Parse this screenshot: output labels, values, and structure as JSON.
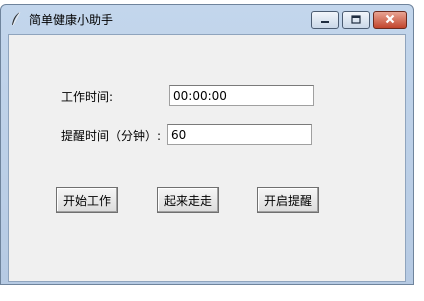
{
  "window": {
    "title": "简单健康小助手"
  },
  "form": {
    "work_time_label": "工作时间:",
    "work_time_value": "00:00:00",
    "remind_label": "提醒时间（分钟）:",
    "remind_value": "60"
  },
  "buttons": {
    "start_work": "开始工作",
    "walk_around": "起来走走",
    "enable_remind": "开启提醒"
  }
}
